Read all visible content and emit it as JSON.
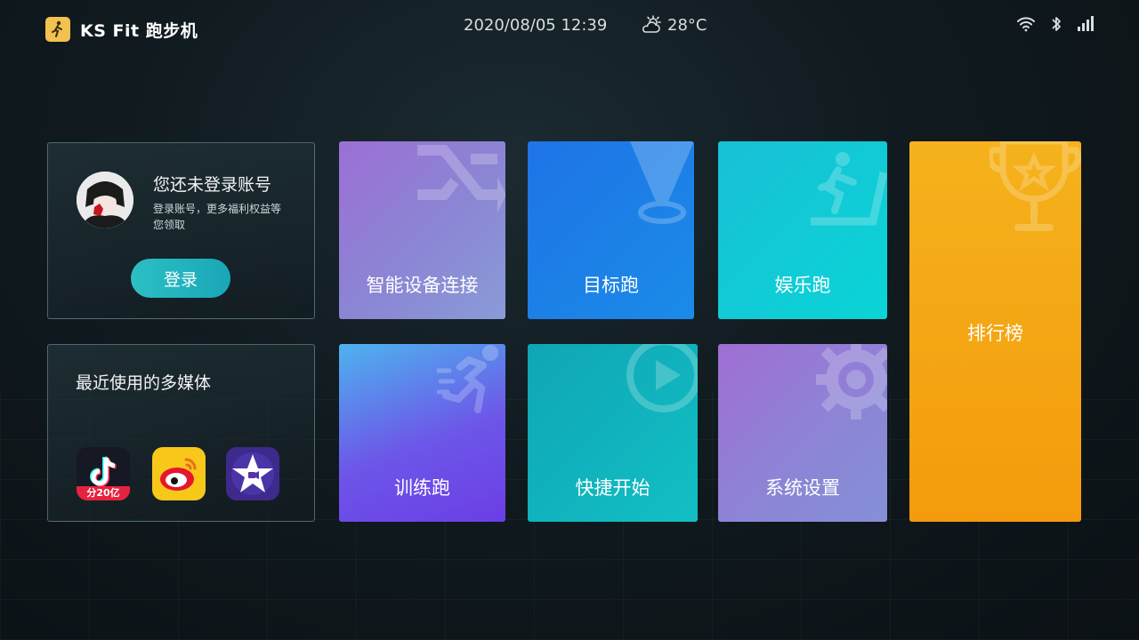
{
  "header": {
    "app_title": "KS Fit 跑步机",
    "datetime": "2020/08/05 12:39",
    "temperature": "28°C",
    "icons": [
      "runner-logo-icon",
      "weather-partly-sunny-icon",
      "wifi-icon",
      "bluetooth-icon",
      "signal-icon"
    ]
  },
  "login_card": {
    "title": "您还未登录账号",
    "subtitle": "登录账号，更多福利权益等您领取",
    "button_label": "登录"
  },
  "media_card": {
    "title": "最近使用的多媒体",
    "apps": [
      {
        "name": "douyin-app-icon",
        "badge": "分20亿"
      },
      {
        "name": "weibo-app-icon"
      },
      {
        "name": "imovie-app-icon"
      }
    ]
  },
  "tiles": [
    {
      "label": "智能设备连接",
      "icon": "shuffle-icon"
    },
    {
      "label": "目标跑",
      "icon": "location-pin-icon"
    },
    {
      "label": "娱乐跑",
      "icon": "treadmill-runner-icon"
    },
    {
      "label": "排行榜",
      "icon": "trophy-icon"
    },
    {
      "label": "训练跑",
      "icon": "sprinter-icon"
    },
    {
      "label": "快捷开始",
      "icon": "play-circle-icon"
    },
    {
      "label": "系统设置",
      "icon": "gear-icon"
    }
  ],
  "colors": {
    "background": "#101a1f",
    "login_button": "#1aa6b8",
    "tile_device": "#8b86d4",
    "tile_target": "#1a8be8",
    "tile_fun": "#0ad4d6",
    "tile_ranking": "#f5a714",
    "tile_training": "#6b3ee6",
    "tile_quick": "#12bfc4",
    "tile_settings": "#8b86d6"
  }
}
